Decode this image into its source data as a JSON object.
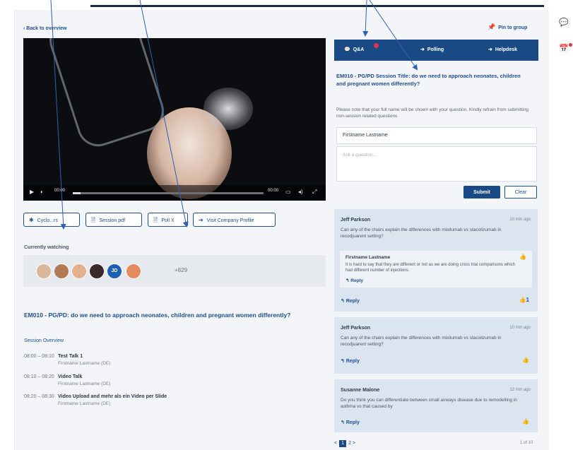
{
  "nav": {
    "back": "Back to overview",
    "pin": "Pin to group"
  },
  "video": {
    "time_current": "00:00",
    "time_total": "00:00",
    "progress_fraction": 0.04
  },
  "actions": {
    "btn1": "Cyclo...rs",
    "btn2": "Session pdf",
    "btn3": "Poll X",
    "btn4": "Visit Company Profile"
  },
  "watching": {
    "label": "Currently watching",
    "initials": "JD",
    "more": "+829"
  },
  "session": {
    "title": "EM010 - PG/PD: do we need to approach neonates, children and pregnant women differently?",
    "overview": "Session Overview",
    "agenda": [
      {
        "time": "08:00 – 08:10",
        "name": "Test Talk 1",
        "speaker": "Firstname Lastname (DE)"
      },
      {
        "time": "08:10 – 08:20",
        "name": "Video Talk",
        "speaker": "Firstname Lastname (DE)"
      },
      {
        "time": "08:20 – 08:30",
        "name": "Video Upload and mehr als ein Video per Slide",
        "speaker": "Firstname Lastname (DE)"
      }
    ]
  },
  "panel": {
    "tabs": [
      "Q&A",
      "Polling",
      "Helpdesk"
    ],
    "title": "EM010 - PG/PD Session Title: do we need to approach neonates, children and pregnant women differently?",
    "note": "Please note that your full name will be shown with your question. Kindly refrain from submitting non-session related questions",
    "name_value": "Firstname Lastname",
    "question_placeholder": "Ask a question...",
    "submit": "Submit",
    "clear": "Clear"
  },
  "questions": [
    {
      "author": "Jeff Parkson",
      "time": "10 min ago",
      "body": "Can any of the chairs explain the differences with mixilumab vs stacolizumab in recodjuarent setting?",
      "answer_author": "Firstname Lastname",
      "answer_body": "It is hard to say that they are different or not as we are doing cross trial comparisons which had different number of injections.",
      "answer_reply": "Reply",
      "reply": "Reply",
      "likes": "1"
    },
    {
      "author": "Jeff Parkson",
      "time": "10 min ago",
      "body": "Can any of the chairs explain the differences with mixilumab vs stacolizumab in recodjuarent setting?",
      "reply": "Reply"
    },
    {
      "author": "Susanne Malone",
      "time": "12 min ago",
      "body": "Do you think you can differentiate between small airways disease due to remodelling in asthma vs that caused by",
      "reply": "Reply"
    }
  ],
  "pagination": {
    "prev": "<",
    "current": "1",
    "next_page": "2",
    "next": ">",
    "count": "1 of 10"
  },
  "icons": {
    "chat": "chat-icon",
    "calendar": "calendar-icon",
    "pin": "pin-icon",
    "like": "thumbs-up-icon",
    "reply": "reply-icon"
  },
  "colors": {
    "primary": "#1a4a86",
    "accent": "#1e4f8f",
    "badge": "#e0334c",
    "card": "#dbe5f0",
    "arrow": "#2f5fb8"
  }
}
